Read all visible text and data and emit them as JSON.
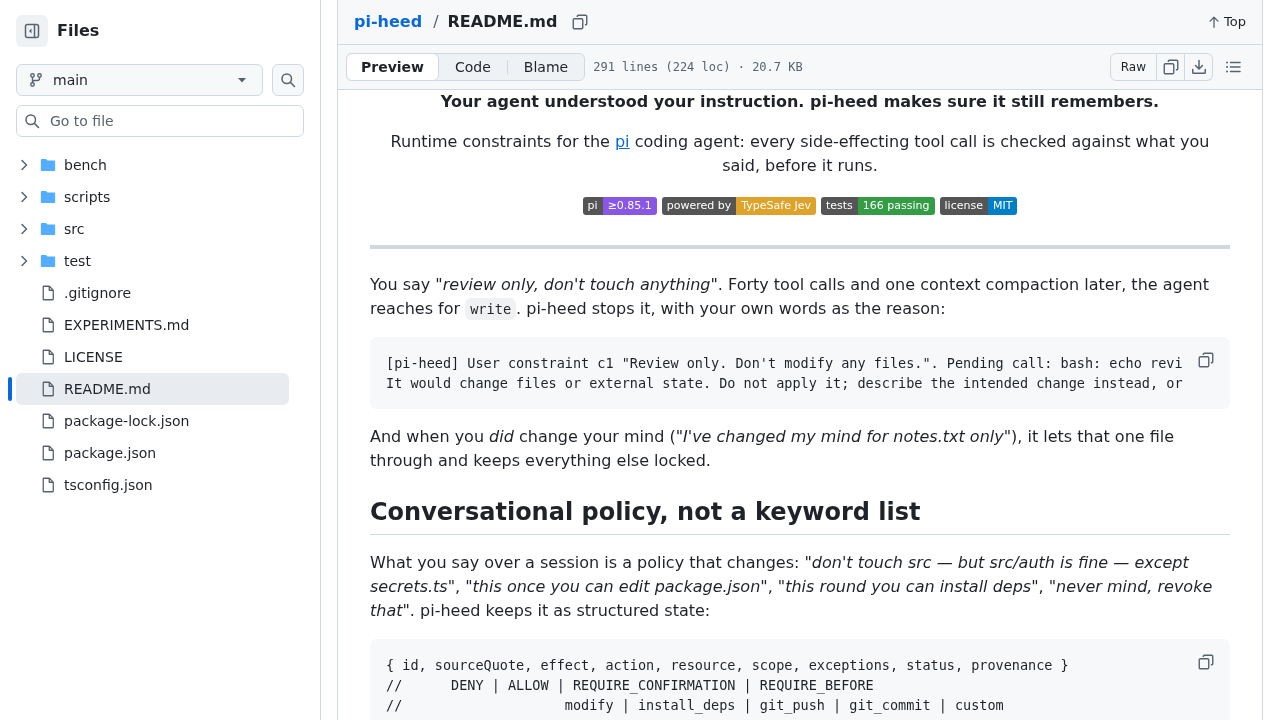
{
  "sidebar": {
    "title": "Files",
    "branch": "main",
    "file_filter": {
      "placeholder": "Go to file"
    },
    "tree": [
      {
        "name": "bench",
        "kind": "folder",
        "expanded": false,
        "selected": false
      },
      {
        "name": "scripts",
        "kind": "folder",
        "expanded": false,
        "selected": false
      },
      {
        "name": "src",
        "kind": "folder",
        "expanded": false,
        "selected": false
      },
      {
        "name": "test",
        "kind": "folder",
        "expanded": false,
        "selected": false
      },
      {
        "name": ".gitignore",
        "kind": "file",
        "selected": false
      },
      {
        "name": "EXPERIMENTS.md",
        "kind": "file",
        "selected": false
      },
      {
        "name": "LICENSE",
        "kind": "file",
        "selected": false
      },
      {
        "name": "README.md",
        "kind": "file",
        "selected": true
      },
      {
        "name": "package-lock.json",
        "kind": "file",
        "selected": false
      },
      {
        "name": "package.json",
        "kind": "file",
        "selected": false
      },
      {
        "name": "tsconfig.json",
        "kind": "file",
        "selected": false
      }
    ]
  },
  "file_header": {
    "repository": "pi-heed",
    "separator": "/",
    "file_name": "README.md",
    "top_link": "Top"
  },
  "file_toolbar": {
    "tabs": [
      {
        "label": "Preview",
        "selected": true
      },
      {
        "label": "Code",
        "selected": false
      },
      {
        "label": "Blame",
        "selected": false
      }
    ],
    "file_info": "291 lines (224 loc) · 20.7 KB",
    "raw_button": "Raw"
  },
  "readme": {
    "blocks": [
      {
        "kind": "tagline",
        "text": "Your agent understood your instruction. pi-heed makes sure it still remembers."
      },
      {
        "kind": "centered_paragraph",
        "segments": [
          {
            "kind": "text",
            "text": "Runtime constraints for the "
          },
          {
            "kind": "link",
            "text": "pi"
          },
          {
            "kind": "text",
            "text": " coding agent: every side-effecting tool call is checked against what you said, before it runs."
          }
        ]
      },
      {
        "kind": "badges",
        "badges": [
          {
            "label": "pi",
            "value": "≥0.85.1",
            "color": "#8957e5"
          },
          {
            "label": "powered by",
            "value": "TypeSafe Jev",
            "color": "#dfa22b"
          },
          {
            "label": "tests",
            "value": "166 passing",
            "color": "#359c46"
          },
          {
            "label": "license",
            "value": "MIT",
            "color": "#007ec6"
          }
        ]
      },
      {
        "kind": "rule"
      },
      {
        "kind": "paragraph",
        "segments": [
          {
            "kind": "text",
            "text": "You say *\"review only, don't touch anything\"*. Forty tool calls and one context compaction later, the agent reaches for "
          },
          {
            "kind": "code",
            "text": "write"
          },
          {
            "kind": "text",
            "text": ". pi-heed stops it, with your own words as the reason:"
          }
        ]
      },
      {
        "kind": "code",
        "lines": [
          "[pi-heed] User constraint c1 \"Review only. Don't modify any files.\". Pending call: bash: echo revi",
          "It would change files or external state. Do not apply it; describe the intended change instead, or"
        ]
      },
      {
        "kind": "paragraph",
        "segments": [
          {
            "kind": "text",
            "text": "And when you *did* change your mind (*\"I've changed my mind for notes.txt only\"*), it lets that one file through and keeps everything else locked."
          }
        ]
      },
      {
        "kind": "heading",
        "text": "Conversational policy, not a keyword list"
      },
      {
        "kind": "paragraph",
        "segments": [
          {
            "kind": "text",
            "text": "What you say over a session is a policy that changes: *\"don't touch src — but src/auth is fine — except secrets.ts\"*, *\"this once you can edit package.json\"*, *\"this round you can install deps\"*, *\"never mind, revoke that\"*. pi-heed keeps it as structured state:"
          }
        ]
      },
      {
        "kind": "code",
        "lines": [
          "{ id, sourceQuote, effect, action, resource, scope, exceptions, status, provenance }",
          "//      DENY | ALLOW | REQUIRE_CONFIRMATION | REQUIRE_BEFORE",
          "//                    modify | install_deps | git_push | git_commit | custom"
        ]
      }
    ]
  }
}
